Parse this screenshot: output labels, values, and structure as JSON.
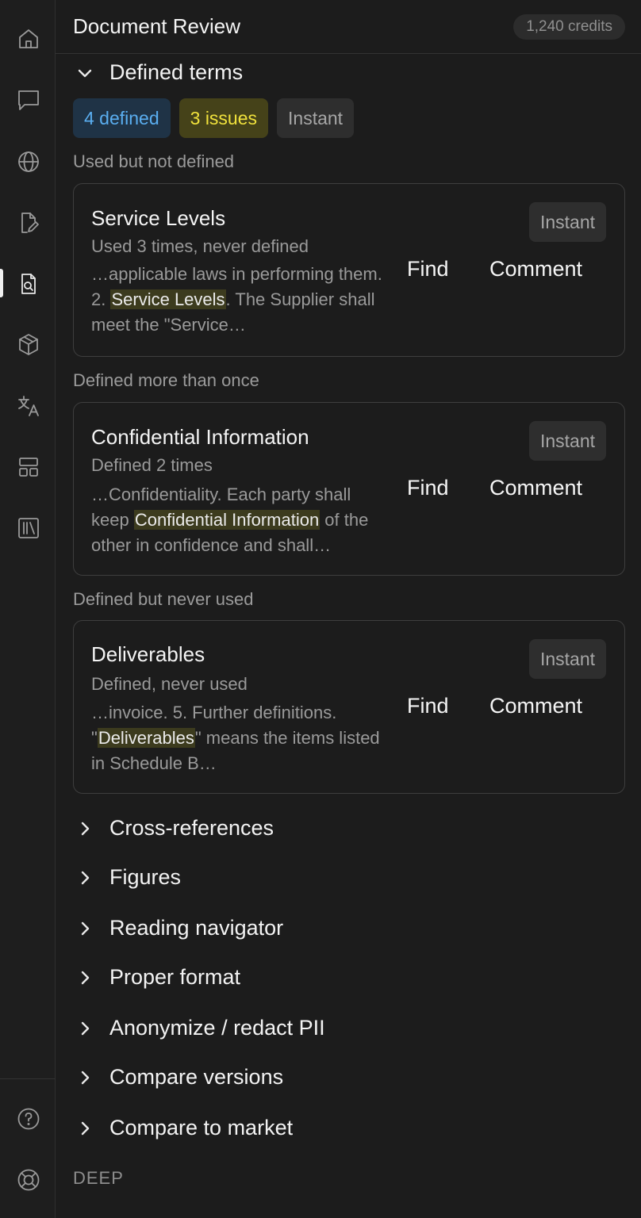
{
  "header": {
    "title": "Document Review",
    "credits": "1,240 credits"
  },
  "defined_terms": {
    "label": "Defined terms",
    "badges": {
      "defined": "4 defined",
      "issues": "3 issues",
      "mode": "Instant"
    },
    "groups": [
      {
        "label": "Used but not defined",
        "card": {
          "title": "Service Levels",
          "meta": "Used 3 times, never defined",
          "snippet_before": "…applicable laws in performing them. 2. ",
          "snippet_highlight": "Service Levels",
          "snippet_after": ". The Supplier shall meet the \"Service…",
          "tag": "Instant",
          "find": "Find",
          "comment": "Comment"
        }
      },
      {
        "label": "Defined more than once",
        "card": {
          "title": "Confidential Information",
          "meta": "Defined 2 times",
          "snippet_before": "…Confidentiality. Each party shall keep ",
          "snippet_highlight": "Confidential Information",
          "snippet_after": " of the other in confidence and shall…",
          "tag": "Instant",
          "find": "Find",
          "comment": "Comment"
        }
      },
      {
        "label": "Defined but never used",
        "card": {
          "title": "Deliverables",
          "meta": "Defined, never used",
          "snippet_before": "…invoice. 5. Further definitions. \"",
          "snippet_highlight": "Deliverables",
          "snippet_after": "\" means the items listed in Schedule B…",
          "tag": "Instant",
          "find": "Find",
          "comment": "Comment"
        }
      }
    ]
  },
  "sections": [
    "Cross-references",
    "Figures",
    "Reading navigator",
    "Proper format",
    "Anonymize / redact PII",
    "Compare versions",
    "Compare to market"
  ],
  "deep_label": "DEEP",
  "rail_icons": [
    "home-icon",
    "chat-icon",
    "globe-icon",
    "document-edit-icon",
    "document-search-icon",
    "cube-icon",
    "translate-icon",
    "layout-icon",
    "library-icon",
    "help-icon",
    "lifebuoy-icon"
  ]
}
